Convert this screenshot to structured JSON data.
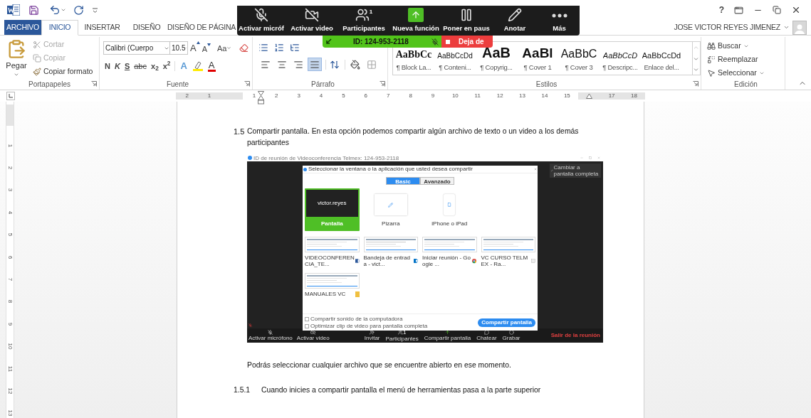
{
  "help_label": "?",
  "user": {
    "name": "JOSE VICTOR REYES JIMENEZ"
  },
  "tabs": [
    {
      "label": "ARCHIVO",
      "kind": "file",
      "selected": false
    },
    {
      "label": "INICIO",
      "kind": "tab",
      "selected": true
    },
    {
      "label": "INSERTAR",
      "kind": "tab",
      "selected": false
    },
    {
      "label": "DISEÑO",
      "kind": "tab",
      "selected": false
    },
    {
      "label": "DISEÑO DE PÁGINA",
      "kind": "tab",
      "selected": false
    }
  ],
  "clipboard": {
    "title": "Portapapeles",
    "paste": "Pegar",
    "items": [
      {
        "label": "Cortar",
        "kind": "cut",
        "disabled": true
      },
      {
        "label": "Copiar",
        "kind": "copy",
        "disabled": true
      },
      {
        "label": "Copiar formato",
        "kind": "format",
        "disabled": false
      }
    ]
  },
  "font": {
    "title": "Fuente",
    "font_name": "Calibri (Cuerpo",
    "font_size": "10.5",
    "size_buttons": [
      {
        "label": "A",
        "kind": "grow"
      },
      {
        "label": "A",
        "kind": "shrink"
      },
      {
        "label": "Aa",
        "kind": "case"
      }
    ],
    "format_buttons": [
      {
        "label": "N",
        "kind": "bold"
      },
      {
        "label": "K",
        "kind": "italic"
      },
      {
        "label": "S",
        "kind": "underline"
      },
      {
        "label": "abc",
        "kind": "strike"
      },
      {
        "label": "x$_{2}$",
        "kind": "plain"
      },
      {
        "label": "x$^{2}$",
        "kind": "plain"
      }
    ],
    "color_buttons": [
      {
        "label": "A",
        "kind": "effect"
      },
      {
        "kind": "highlight"
      },
      {
        "label": "A",
        "kind": "color"
      }
    ]
  },
  "paragraph": {
    "title": "Párrafo",
    "align_buttons": [
      {
        "kind": "left",
        "selected": false
      },
      {
        "kind": "center",
        "selected": false
      },
      {
        "kind": "right",
        "selected": false
      },
      {
        "kind": "justify",
        "selected": true
      }
    ]
  },
  "styles": {
    "title": "Estilos",
    "items": [
      {
        "sample": "AaBbCc",
        "name": "¶ Block La...",
        "kind": "serif"
      },
      {
        "sample": "AaBbCcDd",
        "name": "¶ Conteni...",
        "kind": "small"
      },
      {
        "sample": "AaB",
        "name": "¶ Copyrig...",
        "kind": "huge"
      },
      {
        "sample": "AaBl",
        "name": "¶ Cover 1",
        "kind": "large"
      },
      {
        "sample": "AaBbC",
        "name": "¶ Cover 3",
        "kind": "medium"
      },
      {
        "sample": "AaBbCcD",
        "name": "¶ Descripc...",
        "kind": "italic"
      },
      {
        "sample": "AaBbCcDd",
        "name": "Enlace del...",
        "kind": "normal"
      }
    ]
  },
  "editing": {
    "title": "Edición",
    "items": [
      {
        "label": "Buscar",
        "kind": "find"
      },
      {
        "label": "Reemplazar",
        "kind": "replace"
      },
      {
        "label": "Seleccionar",
        "kind": "select"
      }
    ]
  },
  "ruler": {
    "ticks": [
      {
        "kind": "number",
        "label": "2"
      },
      {
        "kind": "number",
        "label": "1"
      },
      {
        "kind": "blank"
      },
      {
        "kind": "number",
        "label": "1"
      },
      {
        "kind": "number",
        "label": "2"
      },
      {
        "kind": "number",
        "label": "3"
      },
      {
        "kind": "number",
        "label": "4"
      },
      {
        "kind": "number",
        "label": "5"
      },
      {
        "kind": "number",
        "label": "6"
      },
      {
        "kind": "number",
        "label": "7"
      },
      {
        "kind": "number",
        "label": "8"
      },
      {
        "kind": "number",
        "label": "9"
      },
      {
        "kind": "number",
        "label": "10"
      },
      {
        "kind": "number",
        "label": "11"
      },
      {
        "kind": "number",
        "label": "12"
      },
      {
        "kind": "number",
        "label": "13"
      },
      {
        "kind": "number",
        "label": "14"
      },
      {
        "kind": "number",
        "label": "15"
      },
      {
        "kind": "marker"
      },
      {
        "kind": "number",
        "label": "17"
      },
      {
        "kind": "number",
        "label": "18"
      }
    ]
  },
  "vertical_ruler": {
    "ticks": [
      "1",
      "2",
      "3",
      "4",
      "5",
      "6",
      "7",
      "8",
      "9",
      "10",
      "11",
      "12",
      "13"
    ]
  },
  "document": {
    "heading": {
      "number": "1.5",
      "text": "Compartir pantalla. En esta opción podemos compartir algún archivo de texto o un video a los demás participantes"
    },
    "screenshot": {
      "window_title": "ID de reunión de Videoconferencia Telmex: 124-953-2118",
      "fullscreen_label": "Cambiar a pantalla completa",
      "dialog": {
        "title": "Seleccionar la ventana o la aplicación que usted desea compartir",
        "tabs": [
          {
            "label": "Basic",
            "selected": true
          },
          {
            "label": "Avanzado",
            "selected": false
          }
        ],
        "tiles": [
          {
            "label": "Pantalla",
            "kind": "screen",
            "selected": true,
            "thumbnail_text": "victor.reyes"
          },
          {
            "label": "Pizarra",
            "kind": "whiteboard",
            "selected": false
          },
          {
            "label": "iPhone o iPad",
            "kind": "iphone",
            "selected": false
          },
          {
            "label": "VIDEOCONFERENCIA_TE...",
            "kind": "window",
            "icon": {
              "kind": "word"
            },
            "selected": false
          },
          {
            "label": "Bandeja de entrada - vict...",
            "kind": "window",
            "icon": {
              "kind": "outlook"
            },
            "selected": false
          },
          {
            "label": "Iniciar reunión - Google ...",
            "kind": "window",
            "icon": {
              "kind": "chrome"
            },
            "selected": false
          },
          {
            "label": "VC CURSO TELMEX - Ra...",
            "kind": "window",
            "icon": {
              "kind": "calendar"
            },
            "selected": false
          },
          {
            "label": "MANUALES VC",
            "kind": "window",
            "icon": {
              "kind": "folder"
            },
            "selected": false
          }
        ],
        "options": [
          {
            "label": "Compartir sonido de la computadora",
            "checked": false
          },
          {
            "label": "Optimizar clip de video para pantalla completa",
            "checked": false
          }
        ],
        "share_button": "Compartir pantalla"
      },
      "toolbar": [
        {
          "label": "Activar micrófono",
          "kind": "mic"
        },
        {
          "label": "Activar video",
          "kind": "video"
        },
        {
          "label": "Invitar",
          "kind": "invite"
        },
        {
          "label": "Participantes",
          "kind": "participants",
          "count": "1"
        },
        {
          "label": "Compartir pantalla",
          "kind": "share"
        },
        {
          "label": "Chatear",
          "kind": "chat"
        },
        {
          "label": "Grabar",
          "kind": "record"
        }
      ],
      "leave_label": "Salir de la reunión"
    },
    "body": "Podrás seleccionar cualquier archivo que se encuentre abierto en ese momento.",
    "subheading": {
      "number": "1.5.1",
      "text": "Cuando inicies a compartir pantalla el menú de herramientas pasa a la parte superior"
    }
  },
  "zoom_toolbar": {
    "buttons": [
      {
        "label": "Activar micróf",
        "kind": "mic"
      },
      {
        "label": "Activar video",
        "kind": "video"
      },
      {
        "label": "Participantes",
        "kind": "participants",
        "count": "1"
      },
      {
        "label": "Nueva función",
        "kind": "share"
      },
      {
        "label": "Poner en paus",
        "kind": "pause"
      },
      {
        "label": "Anotar",
        "kind": "annotate"
      },
      {
        "label": "Más",
        "kind": "more"
      }
    ],
    "meeting_id": "ID: 124-953-2118",
    "stop_label": "Deja de"
  }
}
